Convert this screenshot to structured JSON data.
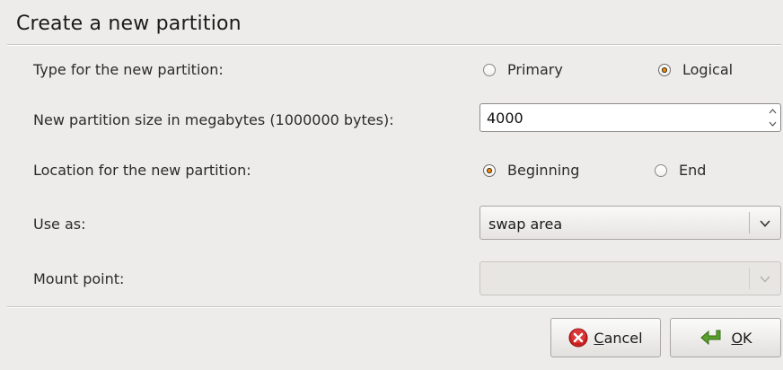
{
  "dialog": {
    "title": "Create a new partition"
  },
  "type_row": {
    "label": "Type for the new partition:",
    "options": [
      {
        "label": "Primary",
        "selected": false
      },
      {
        "label": "Logical",
        "selected": true
      }
    ]
  },
  "size_row": {
    "label": "New partition size in megabytes (1000000 bytes):",
    "value": "4000"
  },
  "location_row": {
    "label": "Location for the new partition:",
    "options": [
      {
        "label": "Beginning",
        "selected": true
      },
      {
        "label": "End",
        "selected": false
      }
    ]
  },
  "use_as_row": {
    "label": "Use as:",
    "value": "swap area"
  },
  "mount_row": {
    "label": "Mount point:",
    "value": "",
    "disabled": true
  },
  "buttons": {
    "cancel": {
      "label_mnemonic": "C",
      "label_rest": "ancel",
      "icon": "cancel-icon"
    },
    "ok": {
      "label_mnemonic": "O",
      "label_rest": "K",
      "icon": "ok-arrow-icon"
    }
  },
  "colors": {
    "background": "#edeceb",
    "radio_accent": "#f28c00",
    "cancel_icon_red": "#cc2020",
    "ok_icon_green": "#5aa02c"
  }
}
